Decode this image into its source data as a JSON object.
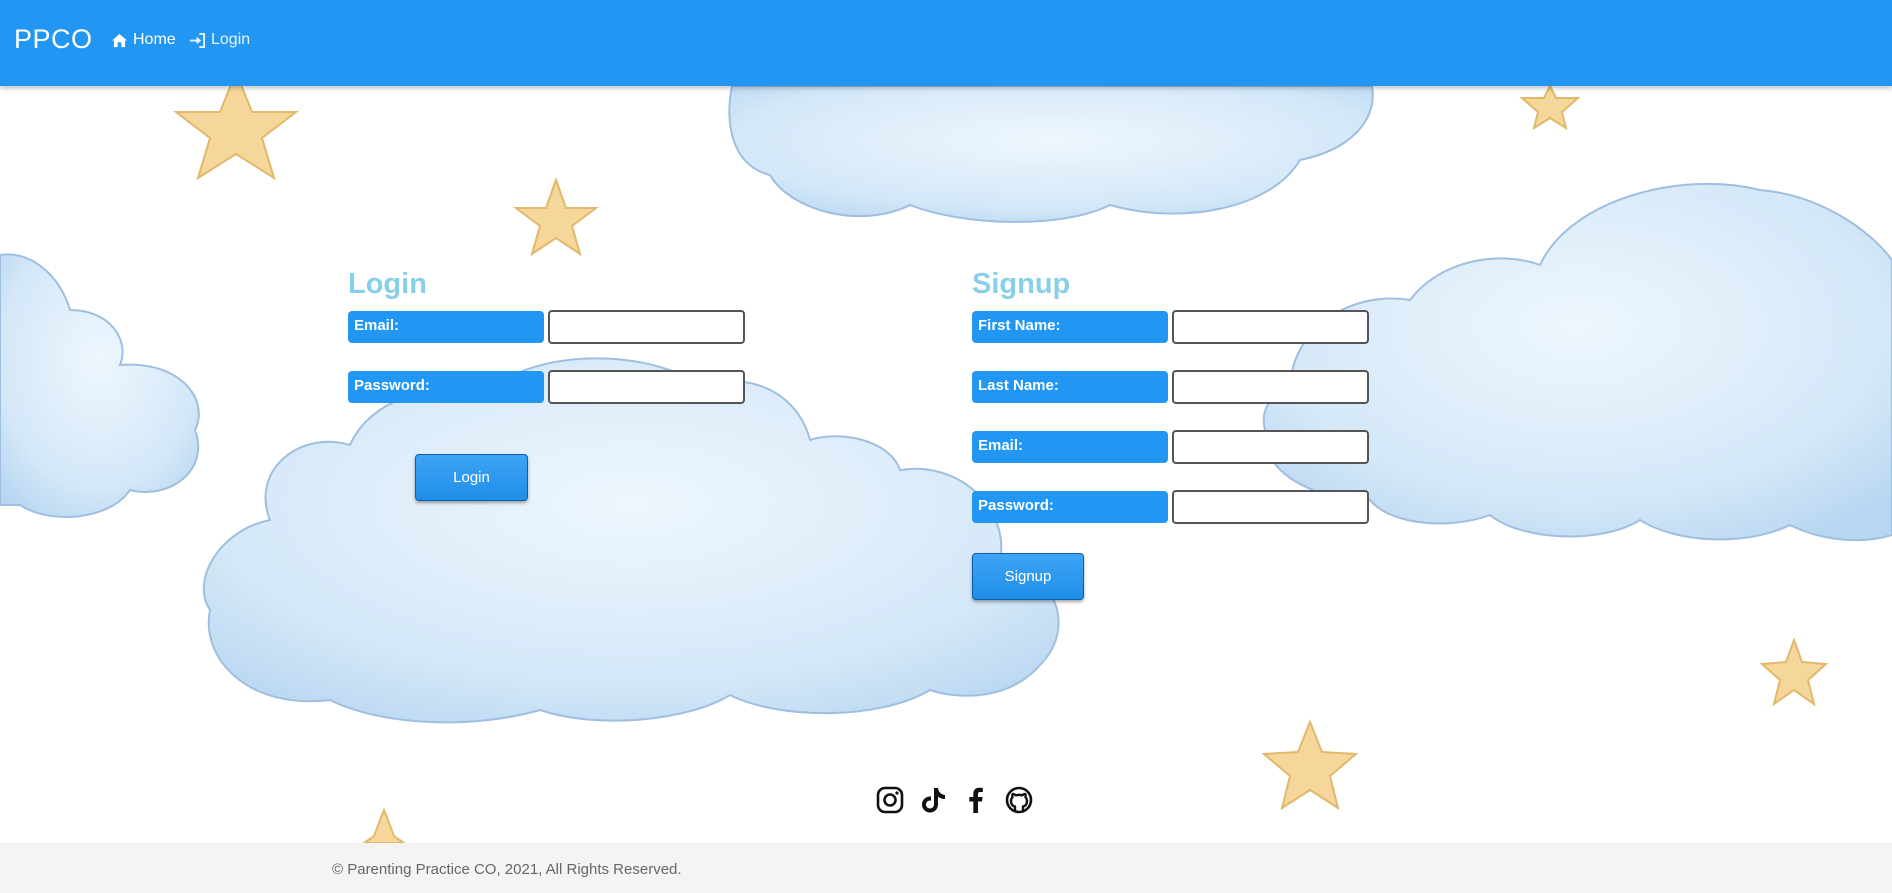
{
  "navbar": {
    "brand": "PPCO",
    "home_label": "Home",
    "login_label": "Login",
    "home_icon": "home-icon",
    "login_icon": "sign-in-icon"
  },
  "login": {
    "title": "Login",
    "email_label": "Email:",
    "email_value": "",
    "password_label": "Password:",
    "password_value": "",
    "button_label": "Login"
  },
  "signup": {
    "title": "Signup",
    "first_name_label": "First Name:",
    "first_name_value": "",
    "last_name_label": "Last Name:",
    "last_name_value": "",
    "email_label": "Email:",
    "email_value": "",
    "password_label": "Password:",
    "password_value": "",
    "button_label": "Signup"
  },
  "social": [
    "instagram-icon",
    "tiktok-icon",
    "facebook-icon",
    "github-icon"
  ],
  "footer": {
    "copyright": "© Parenting Practice CO, 2021, All Rights Reserved."
  },
  "colors": {
    "primary": "#2196f3",
    "section_title": "#88cfe9",
    "footer_bg": "#f4f4f4",
    "footer_text": "#666666"
  }
}
